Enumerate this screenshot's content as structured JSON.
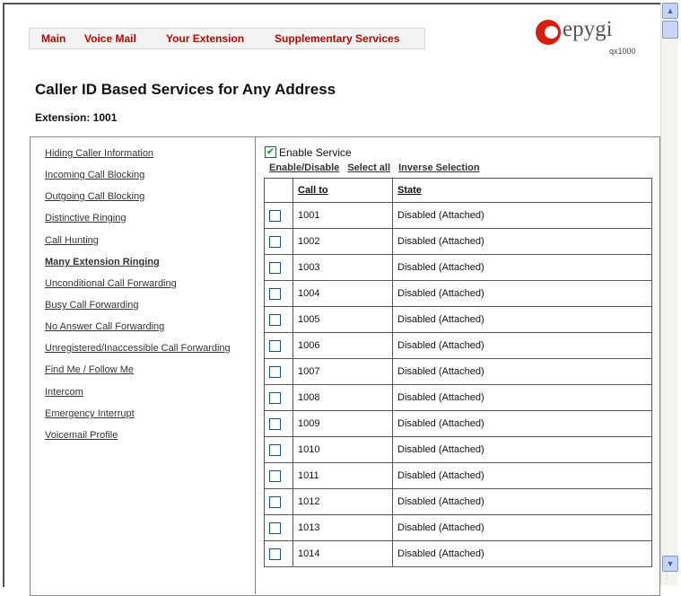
{
  "nav": {
    "items": [
      "Main",
      "Voice Mail",
      "Your Extension",
      "Supplementary Services"
    ]
  },
  "logo": {
    "brand": "epygi",
    "model": "qx1000"
  },
  "page": {
    "title": "Caller ID Based Services for Any Address",
    "extension_line": "Extension: 1001"
  },
  "sidebar": {
    "items": [
      "Hiding Caller Information",
      "Incoming Call Blocking",
      "Outgoing Call Blocking",
      "Distinctive Ringing",
      "Call Hunting",
      "Many Extension Ringing",
      "Unconditional Call Forwarding",
      "Busy Call Forwarding",
      "No Answer Call Forwarding",
      "Unregistered/Inaccessible Call Forwarding",
      "Find Me / Follow Me",
      "Intercom",
      "Emergency Interrupt",
      "Voicemail Profile"
    ],
    "active": "Many Extension Ringing"
  },
  "service": {
    "enable_label": "Enable Service",
    "enabled": true,
    "actions": [
      "Enable/Disable",
      "Select all",
      "Inverse Selection"
    ]
  },
  "table": {
    "headers": [
      "Call to",
      "State"
    ],
    "rows": [
      {
        "call_to": "1001",
        "state": "Disabled (Attached)"
      },
      {
        "call_to": "1002",
        "state": "Disabled (Attached)"
      },
      {
        "call_to": "1003",
        "state": "Disabled (Attached)"
      },
      {
        "call_to": "1004",
        "state": "Disabled (Attached)"
      },
      {
        "call_to": "1005",
        "state": "Disabled (Attached)"
      },
      {
        "call_to": "1006",
        "state": "Disabled (Attached)"
      },
      {
        "call_to": "1007",
        "state": "Disabled (Attached)"
      },
      {
        "call_to": "1008",
        "state": "Disabled (Attached)"
      },
      {
        "call_to": "1009",
        "state": "Disabled (Attached)"
      },
      {
        "call_to": "1010",
        "state": "Disabled (Attached)"
      },
      {
        "call_to": "1011",
        "state": "Disabled (Attached)"
      },
      {
        "call_to": "1012",
        "state": "Disabled (Attached)"
      },
      {
        "call_to": "1013",
        "state": "Disabled (Attached)"
      },
      {
        "call_to": "1014",
        "state": "Disabled (Attached)"
      }
    ]
  },
  "colors": {
    "nav_link": "#c00000",
    "logo_red": "#d61e0d"
  }
}
